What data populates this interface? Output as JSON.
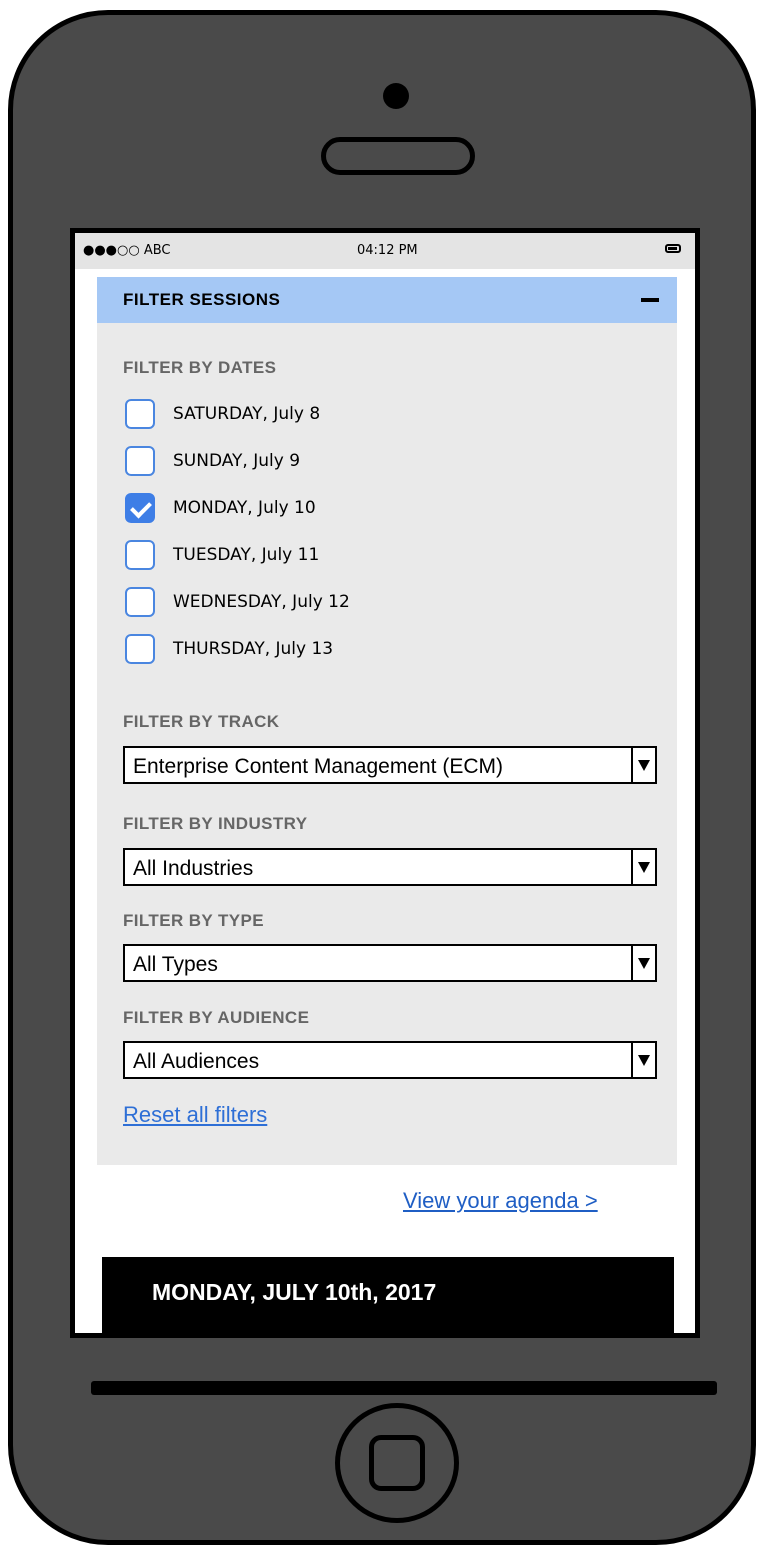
{
  "status_bar": {
    "carrier": "●●●○○ ABC",
    "time": "04:12 PM",
    "battery_icon": "battery-icon"
  },
  "filter_panel": {
    "title": "FILTER SESSIONS",
    "collapse_icon": "minus-icon",
    "dates_label": "FILTER BY DATES",
    "dates": [
      {
        "label": "SATURDAY, July 8",
        "checked": false
      },
      {
        "label": "SUNDAY, July 9",
        "checked": false
      },
      {
        "label": "MONDAY, July 10",
        "checked": true
      },
      {
        "label": "TUESDAY, July 11",
        "checked": false
      },
      {
        "label": "WEDNESDAY, July 12",
        "checked": false
      },
      {
        "label": "THURSDAY, July 13",
        "checked": false
      }
    ],
    "track_label": "FILTER BY TRACK",
    "track_value": "Enterprise Content Management (ECM)",
    "industry_label": "FILTER BY INDUSTRY",
    "industry_value": "All Industries",
    "type_label": "FILTER BY TYPE",
    "type_value": "All Types",
    "audience_label": "FILTER BY AUDIENCE",
    "audience_value": "All Audiences",
    "reset_label": "Reset all filters"
  },
  "agenda_link": "View your agenda >",
  "day_banner": "MONDAY, JULY 10th, 2017",
  "colors": {
    "header_bg": "#a5c8f5",
    "panel_bg": "#eaeaea",
    "checkbox_accent": "#3e7ee6",
    "link": "#2e6fd6"
  }
}
